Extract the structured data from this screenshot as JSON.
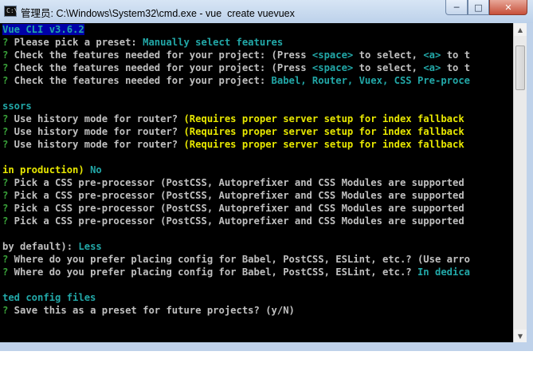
{
  "window": {
    "title": "管理员: C:\\Windows\\System32\\cmd.exe - vue  create vuevuex",
    "app_icon_text": "C:\\",
    "min_label": "─",
    "max_label": "□",
    "close_label": "✕"
  },
  "terminal": {
    "header": "Vue CLI v3.6.2",
    "colors": {
      "prompt": "#3aa33a",
      "answer": "#22a8a8",
      "warning": "#e8e800",
      "text": "#c0c0c0",
      "background": "#000000"
    },
    "l1": {
      "q": "?",
      "text": " Please pick a preset: ",
      "answer": "Manually select features"
    },
    "l2": {
      "q": "?",
      "text": " Check the features needed for your project: (Press ",
      "k1": "<space>",
      "m1": " to select, ",
      "k2": "<a>",
      "m2": " to t"
    },
    "l3": {
      "q": "?",
      "text": " Check the features needed for your project: (Press ",
      "k1": "<space>",
      "m1": " to select, ",
      "k2": "<a>",
      "m2": " to t"
    },
    "l4": {
      "q": "?",
      "text": " Check the features needed for your project: ",
      "answer": "Babel, Router, Vuex, CSS Pre-proce"
    },
    "l5": {
      "answer": "ssors"
    },
    "l6": {
      "q": "?",
      "text": " Use history mode for router? ",
      "warn": "(Requires proper server setup for index fallback"
    },
    "l7": {
      "q": "?",
      "text": " Use history mode for router? ",
      "warn": "(Requires proper server setup for index fallback"
    },
    "l8": {
      "q": "?",
      "text": " Use history mode for router? ",
      "warn": "(Requires proper server setup for index fallback"
    },
    "l9": {
      "warn": "in production)",
      "answer": " No"
    },
    "l10": {
      "q": "?",
      "text": " Pick a CSS pre-processor (PostCSS, Autoprefixer and CSS Modules are supported"
    },
    "l11": {
      "q": "?",
      "text": " Pick a CSS pre-processor (PostCSS, Autoprefixer and CSS Modules are supported"
    },
    "l12": {
      "q": "?",
      "text": " Pick a CSS pre-processor (PostCSS, Autoprefixer and CSS Modules are supported"
    },
    "l13": {
      "q": "?",
      "text": " Pick a CSS pre-processor (PostCSS, Autoprefixer and CSS Modules are supported"
    },
    "l14": {
      "text": "by default): ",
      "answer": "Less"
    },
    "l15": {
      "q": "?",
      "text": " Where do you prefer placing config for Babel, PostCSS, ESLint, etc.? (Use arro"
    },
    "l16": {
      "q": "?",
      "text": " Where do you prefer placing config for Babel, PostCSS, ESLint, etc.? ",
      "answer": "In dedica"
    },
    "l17": {
      "answer": "ted config files"
    },
    "l18": {
      "q": "?",
      "text": " Save this as a preset for future projects? (y/N)"
    }
  },
  "scrollbar": {
    "up_label": "▲",
    "down_label": "▼"
  }
}
